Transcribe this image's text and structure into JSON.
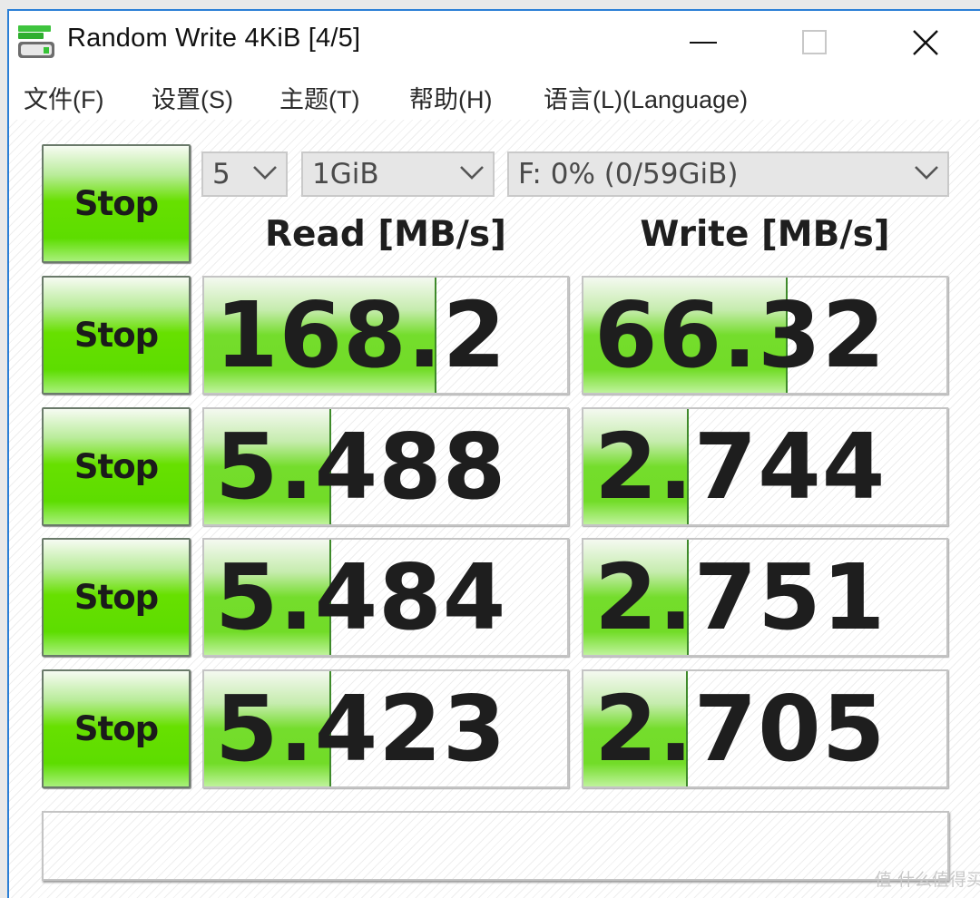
{
  "window": {
    "title": "Random Write 4KiB [4/5]",
    "app_icon": "drive-icon",
    "controls": {
      "minimize": "minimize-icon",
      "maximize": "maximize-icon",
      "close": "close-icon"
    }
  },
  "menu": {
    "items": [
      {
        "label": "文件(F)"
      },
      {
        "label": "设置(S)"
      },
      {
        "label": "主题(T)"
      },
      {
        "label": "帮助(H)"
      },
      {
        "label": "语言(L)(Language)"
      }
    ]
  },
  "toolbar": {
    "all_button_label": "Stop",
    "count_select": {
      "value": "5"
    },
    "size_select": {
      "value": "1GiB"
    },
    "drive_select": {
      "value": "F: 0% (0/59GiB)"
    }
  },
  "headers": {
    "read": "Read [MB/s]",
    "write": "Write [MB/s]"
  },
  "tests": [
    {
      "button_label": "Stop",
      "read": "168.2",
      "write": "66.32",
      "read_bar_fraction": 0.636,
      "write_bar_fraction": 0.557
    },
    {
      "button_label": "Stop",
      "read": "5.488",
      "write": "2.744",
      "read_bar_fraction": 0.344,
      "write_bar_fraction": 0.285
    },
    {
      "button_label": "Stop",
      "read": "5.484",
      "write": "2.751",
      "read_bar_fraction": 0.344,
      "write_bar_fraction": 0.285
    },
    {
      "button_label": "Stop",
      "read": "5.423",
      "write": "2.705",
      "read_bar_fraction": 0.344,
      "write_bar_fraction": 0.283
    }
  ],
  "comment": {
    "value": ""
  },
  "watermark": "值 什么值得买",
  "colors": {
    "accent_border": "#2b7fd6",
    "bar_green": "#74dd2c",
    "button_green": "#5ddd00"
  }
}
